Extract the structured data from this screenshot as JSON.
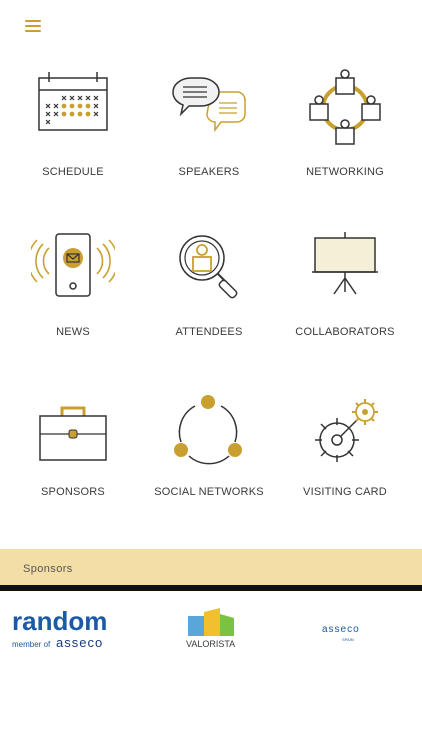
{
  "menu": {
    "icon": "hamburger-menu-icon"
  },
  "tiles": [
    {
      "label": "SCHEDULE",
      "icon": "calendar-icon"
    },
    {
      "label": "SPEAKERS",
      "icon": "speech-bubbles-icon"
    },
    {
      "label": "NETWORKING",
      "icon": "people-network-icon"
    },
    {
      "label": "NEWS",
      "icon": "phone-message-icon"
    },
    {
      "label": "ATTENDEES",
      "icon": "magnifier-person-icon"
    },
    {
      "label": "COLLABORATORS",
      "icon": "projector-screen-icon"
    },
    {
      "label": "SPONSORS",
      "icon": "briefcase-icon"
    },
    {
      "label": "SOCIAL NETWORKS",
      "icon": "social-nodes-icon"
    },
    {
      "label": "VISITING CARD",
      "icon": "gears-target-icon"
    }
  ],
  "sponsors": {
    "title": "Sponsors",
    "logos": [
      {
        "name": "random",
        "sub": "member of",
        "brand": "asseco"
      },
      {
        "name": "VALORISTA"
      },
      {
        "name": "asseco",
        "sub": "SPAIN"
      }
    ]
  },
  "colors": {
    "accent": "#c9a02f",
    "bar": "#f3dfa6",
    "line": "#111111"
  }
}
